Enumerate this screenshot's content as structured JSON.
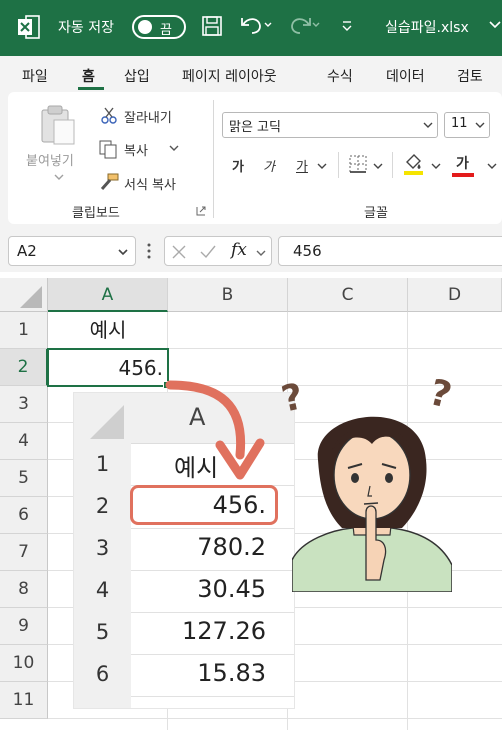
{
  "titlebar": {
    "autosave_label": "자동 저장",
    "toggle_state": "끔",
    "filename": "실습파일.xlsx"
  },
  "tabs": [
    "파일",
    "홈",
    "삽입",
    "페이지 레이아웃",
    "수식",
    "데이터",
    "검토"
  ],
  "ribbon": {
    "paste": "붙여넣기",
    "cut": "잘라내기",
    "copy": "복사",
    "format_painter": "서식 복사",
    "clipboard_group": "클립보드",
    "font_name": "맑은 고딕",
    "font_size": "11",
    "bold": "가",
    "italic": "가",
    "underline": "가",
    "font_color": "가",
    "font_group": "글꼴",
    "accent_yellow": "#f5e400",
    "accent_red": "#e31b1b"
  },
  "formula_bar": {
    "name_box": "A2",
    "fx": "fx",
    "value": "456"
  },
  "sheet": {
    "columns": [
      "A",
      "B",
      "C",
      "D"
    ],
    "rows": [
      "1",
      "2",
      "3",
      "4",
      "5",
      "6",
      "7",
      "8",
      "9",
      "10",
      "11"
    ],
    "a1": "예시",
    "a2": "456."
  },
  "inset": {
    "column": "A",
    "rows": [
      "1",
      "2",
      "3",
      "4",
      "5",
      "6"
    ],
    "values": [
      "예시",
      "456.",
      "780.2",
      "30.45",
      "127.26",
      "15.83"
    ]
  },
  "doodles": {
    "q1": "?",
    "q2": "?"
  },
  "colors": {
    "excel_green": "#1e7145",
    "arrow": "#e0715e"
  }
}
